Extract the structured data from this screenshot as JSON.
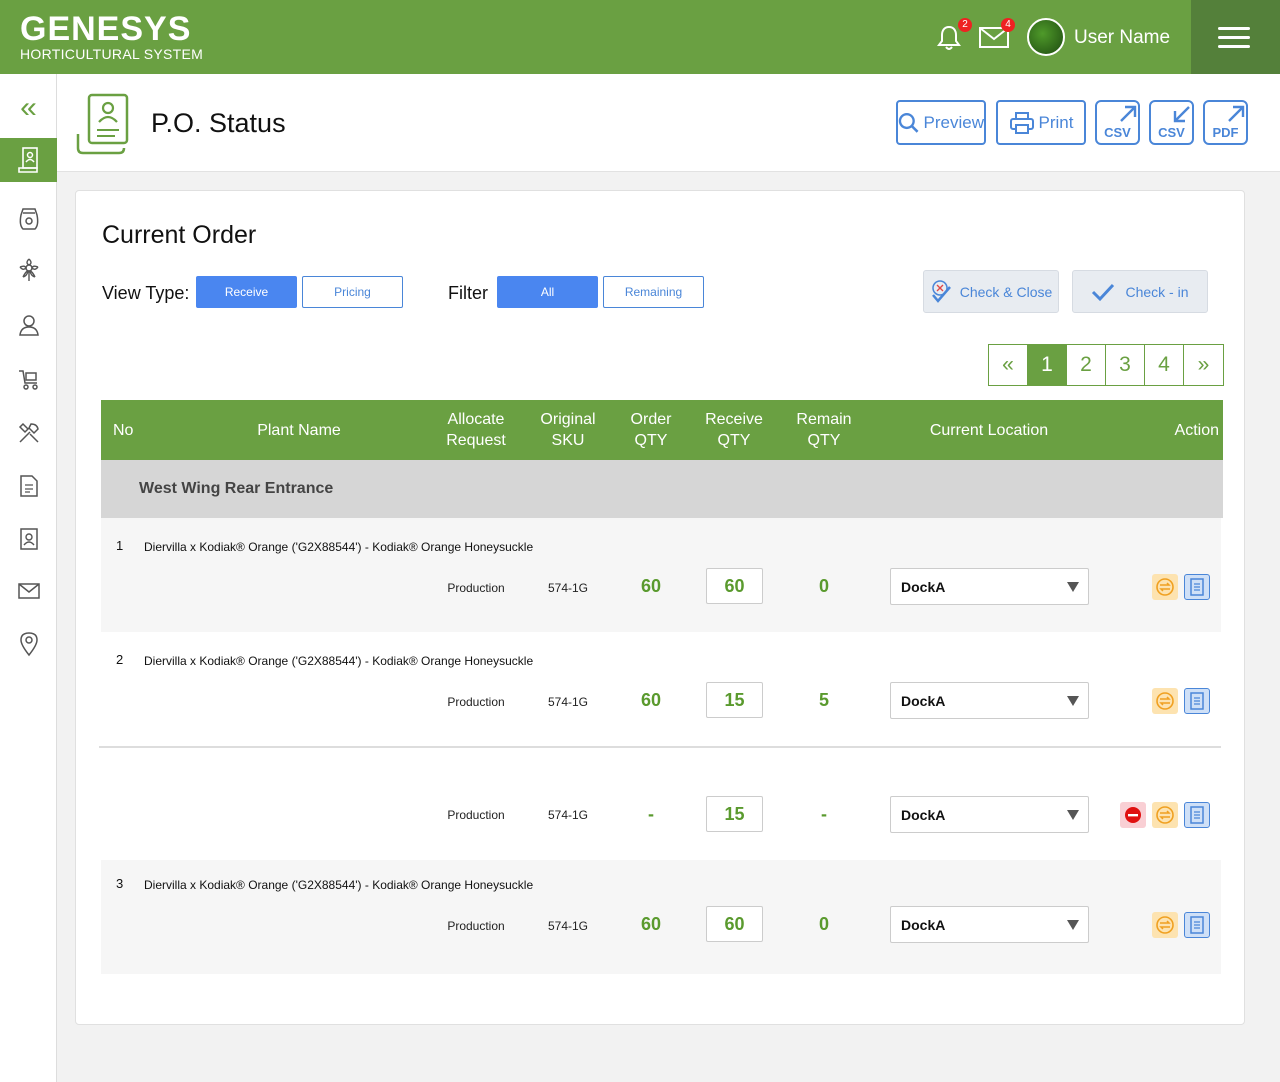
{
  "app": {
    "name": "GENESYS",
    "subtitle": "HORTICULTURAL SYSTEM"
  },
  "topbar": {
    "notifications_count": "2",
    "messages_count": "4",
    "username": "User Name"
  },
  "header": {
    "title": "P.O. Status",
    "preview_label": "Preview",
    "print_label": "Print",
    "csv_export_label": "CSV",
    "csv_import_label": "CSV",
    "pdf_label": "PDF"
  },
  "card": {
    "title": "Current Order",
    "view_type_label": "View Type:",
    "view_types": [
      "Receive",
      "Pricing"
    ],
    "selected_view_type": "Receive",
    "filter_label": "Filter",
    "filters": [
      "All",
      "Remaining"
    ],
    "selected_filter": "All",
    "check_close_label": "Check & Close",
    "check_in_label": "Check - in"
  },
  "pagination": {
    "pages": [
      "1",
      "2",
      "3",
      "4"
    ],
    "current": "1",
    "first_icon": "double-chevron-left",
    "last_icon": "double-chevron-right"
  },
  "table": {
    "headers": [
      "No",
      "Plant Name",
      "Allocate Request",
      "Original SKU",
      "Order QTY",
      "Receive QTY",
      "Remain QTY",
      "Current Location",
      "Action"
    ],
    "group": "West Wing Rear Entrance",
    "rows": [
      {
        "no": "1",
        "plant": "Diervilla x Kodiak® Orange ('G2X88544') - Kodiak® Orange Honeysuckle",
        "allocate": "Production",
        "sku": "574-1G",
        "order_qty": "60",
        "receive_qty": "60",
        "remain_qty": "0",
        "location": "DockA"
      },
      {
        "no": "2",
        "plant": "Diervilla x Kodiak® Orange ('G2X88544') - Kodiak® Orange Honeysuckle",
        "allocate": "Production",
        "sku": "574-1G",
        "order_qty": "60",
        "receive_qty": "15",
        "remain_qty": "5",
        "location": "DockA"
      },
      {
        "no": "",
        "plant": "",
        "allocate": "Production",
        "sku": "574-1G",
        "order_qty": "-",
        "receive_qty": "15",
        "remain_qty": "-",
        "location": "DockA"
      },
      {
        "no": "3",
        "plant": "Diervilla x Kodiak® Orange ('G2X88544') - Kodiak® Orange Honeysuckle",
        "allocate": "Production",
        "sku": "574-1G",
        "order_qty": "60",
        "receive_qty": "60",
        "remain_qty": "0",
        "location": "DockA"
      }
    ]
  },
  "colors": {
    "brand_green": "#6aa042",
    "accent_blue": "#4a86d8",
    "group_gray": "#d6d6d6"
  },
  "icons": {
    "sidebar": [
      "collapse-icon",
      "po-icon",
      "seed-bag-icon",
      "plant-icon",
      "user-icon",
      "cart-icon",
      "tools-icon",
      "document-icon",
      "contact-icon",
      "mail-icon",
      "location-pin-icon"
    ]
  }
}
